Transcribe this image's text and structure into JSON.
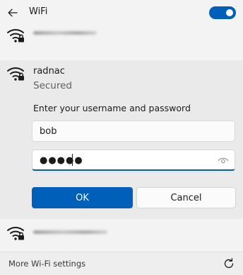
{
  "header": {
    "title": "WiFi",
    "back_icon": "back-arrow-icon",
    "toggle_on": true
  },
  "networks": {
    "top_secured_icon": "wifi-locked-icon",
    "expanded": {
      "name": "radnac",
      "status": "Secured",
      "prompt": "Enter your username and password",
      "username_value": "bob",
      "password_mask": "●●●●●",
      "ok_label": "OK",
      "cancel_label": "Cancel"
    },
    "bottom_secured_icon": "wifi-locked-icon"
  },
  "footer": {
    "link_label": "More Wi-Fi settings",
    "refresh_icon": "refresh-icon"
  },
  "colors": {
    "accent": "#005fb8",
    "panel": "#f3f3f3",
    "expanded_bg": "#eaeaea"
  }
}
